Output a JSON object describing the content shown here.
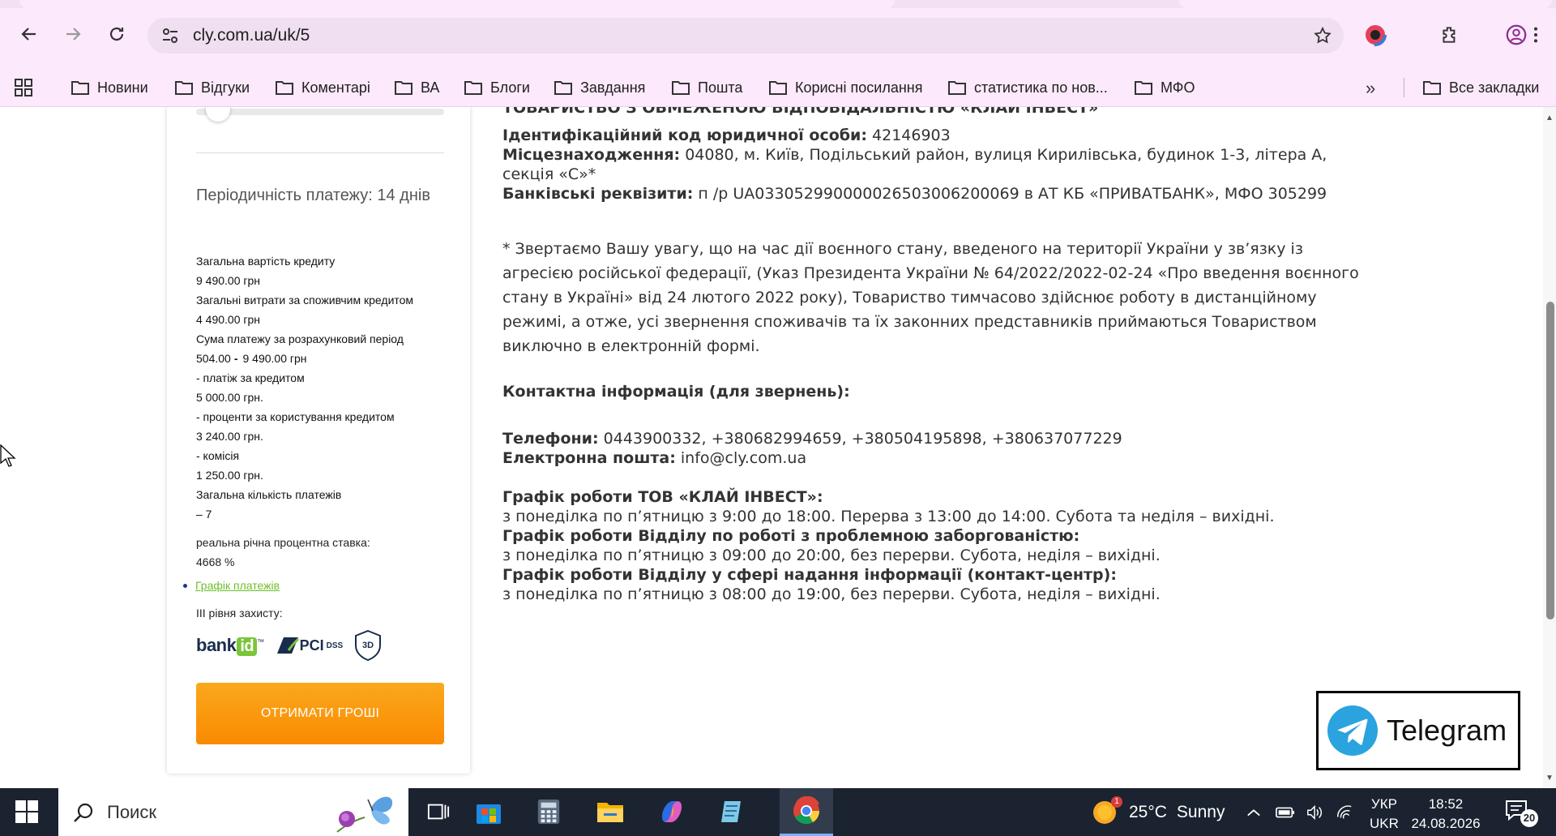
{
  "browser": {
    "url": "cly.com.ua/uk/5",
    "bookmarks": [
      "Новини",
      "Відгуки",
      "Коментарі",
      "ВА",
      "Блоги",
      "Завдання",
      "Пошта",
      "Корисні посилання",
      "статистика по нов...",
      "МФО"
    ],
    "all_bookmarks": "Все закладки",
    "more_bookmarks": "»"
  },
  "calculator": {
    "period": "Періодичність платежу: 14 днів",
    "rows": [
      {
        "label": "Загальна вартість кредиту",
        "value": "9 490.00  грн"
      },
      {
        "label": "Загальні витрати за споживчим кредитом",
        "value": "4 490.00  грн"
      },
      {
        "label": "Сума платежу за розрахунковий період",
        "value_from": "504.00",
        "value_sep": "-",
        "value_to": "9 490.00  грн"
      },
      {
        "label": "- платіж за кредитом",
        "value": "5 000.00  грн."
      },
      {
        "label": "- проценти за користування кредитом",
        "value": "3 240.00  грн."
      },
      {
        "label": "- комісія",
        "value": "1 250.00  грн."
      },
      {
        "label": "Загальна кількість платежів",
        "value": "– 7"
      }
    ],
    "apr_label": "реальна річна процентна ставка:",
    "apr_value": "4668 %",
    "schedule_link": "Графік платежів",
    "security_label": "III рівня захисту:",
    "logos": {
      "bankid": "bank",
      "bankid_id": "id",
      "bankid_tm": "™",
      "pci": "PCI",
      "dss": "DSS",
      "secure": "3D"
    },
    "cta": "ОТРИМАТИ ГРОШІ"
  },
  "company": {
    "name_line": "ТОВАРИСТВО З ОБМЕЖЕНОЮ ВІДПОВІДАЛЬНІСТЮ «КЛАЙ ІНВЕСТ»",
    "code_label": "Ідентифікаційний код юридичної особи:",
    "code_value": "42146903",
    "address_label": "Місцезнаходження:",
    "address_value": "04080, м. Київ, Подільський район, вулиця Кирилівська, будинок 1-3, літера А,",
    "address_value2": "секція «С»*",
    "bank_label": "Банківські реквізити:",
    "bank_value": "п /р UA033052990000026503006200069 в АТ КБ «ПРИВАТБАНК», МФО 305299",
    "notice": "* Звертаємо Вашу увагу, що на час дії воєнного стану, введеного на території України у зв’язку із агресією російської федерації, (Указ Президента України № 64/2022/2022-02-24 «Про введення воєнного стану в Україні» від 24 лютого 2022 року), Товариство тимчасово здійснює роботу в дистанційному режимі, а отже, усі звернення споживачів та їх законних представників приймаються Товариством виключно в електронній формі.",
    "contacts_heading": "Контактна інформація (для звернень):",
    "phones_label": "Телефони:",
    "phones_value": "0443900332, +380682994659, +380504195898, +380637077229",
    "email_label": "Електронна пошта:",
    "email_value": "info@cly.com.ua",
    "schedule1_title": "Графік роботи ТОВ «КЛАЙ ІНВЕСТ»:",
    "schedule1_value": "з понеділка по п’ятницю з 9:00 до 18:00. Перерва з 13:00 до 14:00. Субота та неділя – вихідні.",
    "schedule2_title": "Графік роботи Відділу по роботі з проблемною заборгованістю:",
    "schedule2_value": "з понеділка по п’ятницю з 09:00 до 20:00, без перерви. Субота, неділя – вихідні.",
    "schedule3_title": "Графік роботи Відділу у сфері надання інформації (контакт-центр):",
    "schedule3_value": "з понеділка по п’ятницю з 08:00 до 19:00, без перерви. Субота, неділя – вихідні."
  },
  "telegram": {
    "label": "Telegram"
  },
  "taskbar": {
    "search_placeholder": "Поиск",
    "weather_temp": "25°C",
    "weather_desc": "Sunny",
    "weather_badge": "1",
    "lang_line1": "УКР",
    "lang_line2": "UKR",
    "time": "18:52",
    "date": "24.08.2026",
    "notifications": "20"
  },
  "colors": {
    "accent_orange": "#f98a00",
    "link_green": "#6cbf2a",
    "telegram_blue": "#2aa3df",
    "chrome_bg": "#fce9fb"
  }
}
